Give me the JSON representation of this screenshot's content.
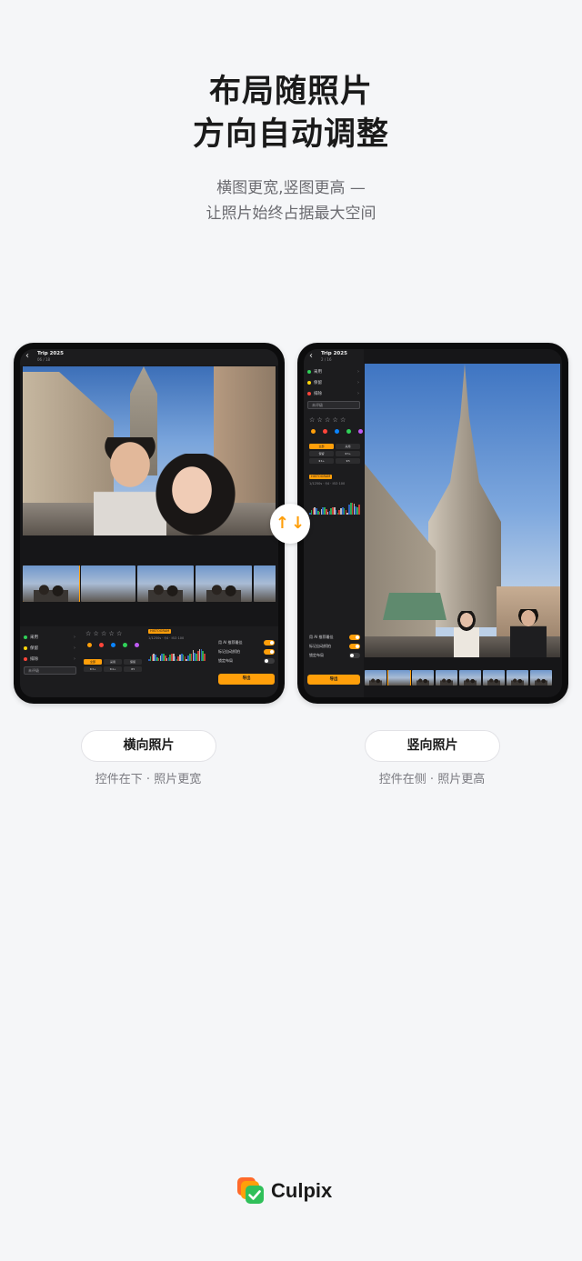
{
  "header": {
    "title_line1": "布局随照片",
    "title_line2": "方向自动调整",
    "subtitle_line1": "横图更宽,竖图更高 —",
    "subtitle_line2": "让照片始终占据最大空间"
  },
  "swap_icon": {
    "up_glyph": "↑",
    "down_glyph": "↓"
  },
  "landscape": {
    "album_title": "Trip 2025",
    "album_sub": "06 / 18",
    "groups": [
      {
        "label": "采用",
        "color": "#30d158"
      },
      {
        "label": "保留",
        "color": "#ffd60a"
      },
      {
        "label": "排除",
        "color": "#ff453a"
      }
    ],
    "search_placeholder": "未评级",
    "stars": "☆ ☆ ☆ ☆ ☆",
    "color_labels": [
      "#ff9f0a",
      "#ff453a",
      "#0a84ff",
      "#30d158",
      "#bf5af2"
    ],
    "chips": [
      "全部",
      "采用",
      "保留",
      "★3+",
      "★4+",
      "★5"
    ],
    "histogram_tag": "HISTOGRAM",
    "exif": "1/1250s · f/4 · ISO 100",
    "toggles": [
      {
        "label": "用 AI 推荐最佳",
        "on": true
      },
      {
        "label": "标记自动抓拍",
        "on": true
      },
      {
        "label": "锁定布局",
        "on": false
      }
    ],
    "export_label": "导出",
    "label_pill": "横向照片",
    "caption": "控件在下 · 照片更宽"
  },
  "portrait": {
    "album_title": "Trip 2025",
    "album_sub": "2 / 16",
    "groups": [
      {
        "label": "采用",
        "color": "#30d158"
      },
      {
        "label": "保留",
        "color": "#ffd60a"
      },
      {
        "label": "排除",
        "color": "#ff453a"
      }
    ],
    "search_placeholder": "未评级",
    "stars": "☆ ☆ ☆ ☆ ☆",
    "color_labels": [
      "#ff9f0a",
      "#ff453a",
      "#0a84ff",
      "#30d158",
      "#bf5af2"
    ],
    "chips": [
      "全部",
      "采用",
      "保留",
      "★3+",
      "★4+",
      "★5"
    ],
    "histogram_tag": "HISTOGRAM",
    "exif": "1/1250s · f/4 · ISO 100",
    "toggles": [
      {
        "label": "用 AI 推荐最佳",
        "on": true
      },
      {
        "label": "标记自动抓拍",
        "on": true
      },
      {
        "label": "锁定布局",
        "on": false
      }
    ],
    "export_label": "导出",
    "label_pill": "竖向照片",
    "caption": "控件在侧 · 照片更高"
  },
  "brand": {
    "name": "Culpix",
    "accent": "#ff9f0a",
    "check_color": "#30c05a"
  }
}
